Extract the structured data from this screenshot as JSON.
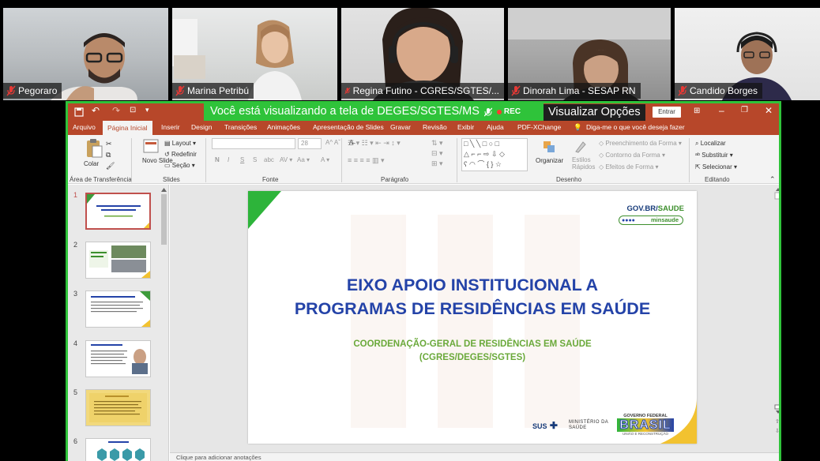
{
  "participants": [
    {
      "name": "Pegoraro"
    },
    {
      "name": "Marina Petribú"
    },
    {
      "name": "Regina Futino - CGRES/SGTES/..."
    },
    {
      "name": "Dinorah Lima - SESAP RN"
    },
    {
      "name": "Candido Borges"
    }
  ],
  "share": {
    "banner_text": "Você está visualizando a tela de DEGES/SGTES/MS",
    "rec_label": "REC",
    "view_options": "Visualizar Opções",
    "enter_button": "Entrar"
  },
  "menu": {
    "items": [
      "Arquivo",
      "Página Inicial",
      "Inserir",
      "Design",
      "Transições",
      "Animações",
      "Apresentação de Slides",
      "Gravar",
      "Revisão",
      "Exibir",
      "Ajuda",
      "PDF-XChange"
    ],
    "active": "Página Inicial",
    "tell_me": "Diga-me o que você deseja fazer"
  },
  "ribbon": {
    "paste": "Colar",
    "clipboard_group": "Área de Transferência",
    "new_slide": "Novo Slide",
    "layout": "Layout",
    "reset": "Redefinir",
    "section": "Seção",
    "slides_group": "Slides",
    "font_size": "28",
    "font_group": "Fonte",
    "paragraph_group": "Parágrafo",
    "arrange": "Organizar",
    "quick_styles": "Estilos Rápidos",
    "shape_fill": "Preenchimento da Forma",
    "shape_outline": "Contorno da Forma",
    "shape_effects": "Efeitos de Forma",
    "drawing_group": "Desenho",
    "find": "Localizar",
    "replace": "Substituir",
    "select": "Selecionar",
    "editing_group": "Editando"
  },
  "thumbnails": [
    {
      "num": "1",
      "title": "EIXO APOIO INSTITUCIONAL A PROGRAMAS DE RESIDÊNCIAS EM SAÚDE"
    },
    {
      "num": "2",
      "title": "A SGTES no Apoio à Residência"
    },
    {
      "num": "3",
      "title": "Coordenação-Geral de Residências em Saúde"
    },
    {
      "num": "4",
      "title": "Tipos de Residência em Saúde"
    },
    {
      "num": "5",
      "title": "PRÓ-RESIDÊNCIA"
    },
    {
      "num": "6",
      "title": "PRÓ-RESIDÊNCIA"
    }
  ],
  "slide": {
    "title_line1": "EIXO APOIO INSTITUCIONAL A",
    "title_line2": "PROGRAMAS DE RESIDÊNCIAS EM SAÚDE",
    "sub_line1": "COORDENAÇÃO-GERAL DE RESIDÊNCIAS EM SAÚDE",
    "sub_line2": "(CGRES/DEGES/SGTES)",
    "gov_prefix": "GOV.BR/",
    "gov_accent": "SAUDE",
    "minsaude": "minsaude",
    "sus": "SUS",
    "ministry": "MINISTÉRIO DA SAÚDE",
    "gov_federal": "GOVERNO FEDERAL",
    "brasil": "BRASIL",
    "motto": "UNIÃO E RECONSTRUÇÃO"
  },
  "notes_placeholder": "Clique para adicionar anotações",
  "colors": {
    "pp_red": "#b7472a",
    "share_green": "#2fc33a",
    "title_blue": "#2443a8",
    "sub_green": "#6aa93a"
  }
}
